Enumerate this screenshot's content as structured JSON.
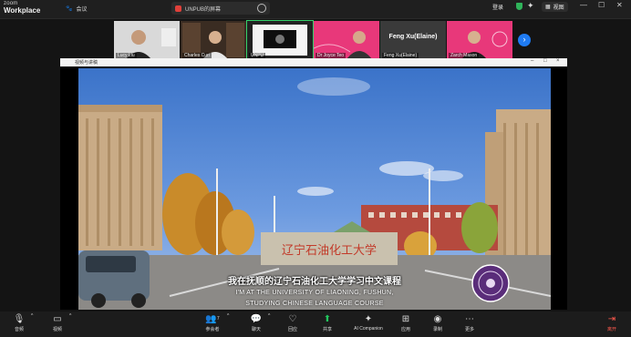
{
  "app": {
    "logo_top": "zoom",
    "logo_bottom": "Workplace"
  },
  "topbar": {
    "meeting_label": "会议",
    "share_pill_label": "UNPUB的屏幕",
    "signin_label": "登录",
    "view_label": "视图",
    "accent_green": "#2fb35a"
  },
  "participants": [
    {
      "name": "Lucy Liu"
    },
    {
      "name": "Charles Curi"
    },
    {
      "name": "UNPU"
    },
    {
      "name": "Dr Joyce Teo"
    },
    {
      "name": "Feng Xu(Elaine)",
      "overlay_name": "Feng Xu(Elaine)"
    },
    {
      "name": "Zarch Mason"
    }
  ],
  "share_window": {
    "title": "视频与讲稿",
    "video": {
      "sign_text": "辽宁石油化工大学",
      "caption_cn": "我在抚顺的辽宁石油化工大学学习中文课程",
      "caption_en_1": "I'M AT THE UNIVERSITY OF LIAONING, FUSHUN,",
      "caption_en_2": "STUDYING CHINESE LANGUAGE COURSE"
    }
  },
  "toolbar": {
    "audio": "音频",
    "video": "视频",
    "participants": "参会者",
    "participants_count": "7",
    "chat": "聊天",
    "react": "回应",
    "share": "共享",
    "ai": "AI Companion",
    "apps": "应用",
    "record": "录制",
    "more": "更多",
    "leave": "离开",
    "share_color": "#22c55e",
    "leave_color": "#ff5a4e"
  }
}
